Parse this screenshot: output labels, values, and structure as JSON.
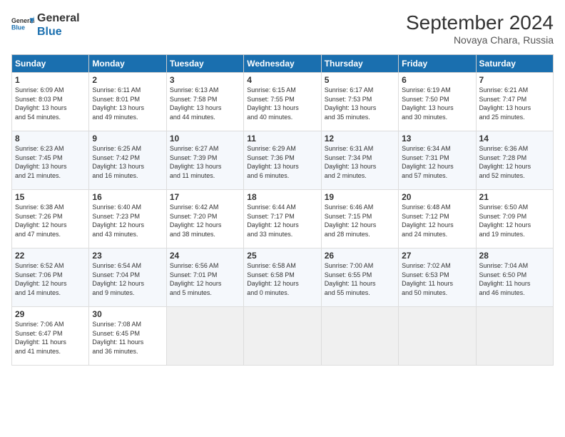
{
  "header": {
    "logo_general": "General",
    "logo_blue": "Blue",
    "month": "September 2024",
    "location": "Novaya Chara, Russia"
  },
  "weekdays": [
    "Sunday",
    "Monday",
    "Tuesday",
    "Wednesday",
    "Thursday",
    "Friday",
    "Saturday"
  ],
  "weeks": [
    [
      {
        "day": "1",
        "info": "Sunrise: 6:09 AM\nSunset: 8:03 PM\nDaylight: 13 hours\nand 54 minutes."
      },
      {
        "day": "2",
        "info": "Sunrise: 6:11 AM\nSunset: 8:01 PM\nDaylight: 13 hours\nand 49 minutes."
      },
      {
        "day": "3",
        "info": "Sunrise: 6:13 AM\nSunset: 7:58 PM\nDaylight: 13 hours\nand 44 minutes."
      },
      {
        "day": "4",
        "info": "Sunrise: 6:15 AM\nSunset: 7:55 PM\nDaylight: 13 hours\nand 40 minutes."
      },
      {
        "day": "5",
        "info": "Sunrise: 6:17 AM\nSunset: 7:53 PM\nDaylight: 13 hours\nand 35 minutes."
      },
      {
        "day": "6",
        "info": "Sunrise: 6:19 AM\nSunset: 7:50 PM\nDaylight: 13 hours\nand 30 minutes."
      },
      {
        "day": "7",
        "info": "Sunrise: 6:21 AM\nSunset: 7:47 PM\nDaylight: 13 hours\nand 25 minutes."
      }
    ],
    [
      {
        "day": "8",
        "info": "Sunrise: 6:23 AM\nSunset: 7:45 PM\nDaylight: 13 hours\nand 21 minutes."
      },
      {
        "day": "9",
        "info": "Sunrise: 6:25 AM\nSunset: 7:42 PM\nDaylight: 13 hours\nand 16 minutes."
      },
      {
        "day": "10",
        "info": "Sunrise: 6:27 AM\nSunset: 7:39 PM\nDaylight: 13 hours\nand 11 minutes."
      },
      {
        "day": "11",
        "info": "Sunrise: 6:29 AM\nSunset: 7:36 PM\nDaylight: 13 hours\nand 6 minutes."
      },
      {
        "day": "12",
        "info": "Sunrise: 6:31 AM\nSunset: 7:34 PM\nDaylight: 13 hours\nand 2 minutes."
      },
      {
        "day": "13",
        "info": "Sunrise: 6:34 AM\nSunset: 7:31 PM\nDaylight: 12 hours\nand 57 minutes."
      },
      {
        "day": "14",
        "info": "Sunrise: 6:36 AM\nSunset: 7:28 PM\nDaylight: 12 hours\nand 52 minutes."
      }
    ],
    [
      {
        "day": "15",
        "info": "Sunrise: 6:38 AM\nSunset: 7:26 PM\nDaylight: 12 hours\nand 47 minutes."
      },
      {
        "day": "16",
        "info": "Sunrise: 6:40 AM\nSunset: 7:23 PM\nDaylight: 12 hours\nand 43 minutes."
      },
      {
        "day": "17",
        "info": "Sunrise: 6:42 AM\nSunset: 7:20 PM\nDaylight: 12 hours\nand 38 minutes."
      },
      {
        "day": "18",
        "info": "Sunrise: 6:44 AM\nSunset: 7:17 PM\nDaylight: 12 hours\nand 33 minutes."
      },
      {
        "day": "19",
        "info": "Sunrise: 6:46 AM\nSunset: 7:15 PM\nDaylight: 12 hours\nand 28 minutes."
      },
      {
        "day": "20",
        "info": "Sunrise: 6:48 AM\nSunset: 7:12 PM\nDaylight: 12 hours\nand 24 minutes."
      },
      {
        "day": "21",
        "info": "Sunrise: 6:50 AM\nSunset: 7:09 PM\nDaylight: 12 hours\nand 19 minutes."
      }
    ],
    [
      {
        "day": "22",
        "info": "Sunrise: 6:52 AM\nSunset: 7:06 PM\nDaylight: 12 hours\nand 14 minutes."
      },
      {
        "day": "23",
        "info": "Sunrise: 6:54 AM\nSunset: 7:04 PM\nDaylight: 12 hours\nand 9 minutes."
      },
      {
        "day": "24",
        "info": "Sunrise: 6:56 AM\nSunset: 7:01 PM\nDaylight: 12 hours\nand 5 minutes."
      },
      {
        "day": "25",
        "info": "Sunrise: 6:58 AM\nSunset: 6:58 PM\nDaylight: 12 hours\nand 0 minutes."
      },
      {
        "day": "26",
        "info": "Sunrise: 7:00 AM\nSunset: 6:55 PM\nDaylight: 11 hours\nand 55 minutes."
      },
      {
        "day": "27",
        "info": "Sunrise: 7:02 AM\nSunset: 6:53 PM\nDaylight: 11 hours\nand 50 minutes."
      },
      {
        "day": "28",
        "info": "Sunrise: 7:04 AM\nSunset: 6:50 PM\nDaylight: 11 hours\nand 46 minutes."
      }
    ],
    [
      {
        "day": "29",
        "info": "Sunrise: 7:06 AM\nSunset: 6:47 PM\nDaylight: 11 hours\nand 41 minutes."
      },
      {
        "day": "30",
        "info": "Sunrise: 7:08 AM\nSunset: 6:45 PM\nDaylight: 11 hours\nand 36 minutes."
      },
      {
        "day": "",
        "info": ""
      },
      {
        "day": "",
        "info": ""
      },
      {
        "day": "",
        "info": ""
      },
      {
        "day": "",
        "info": ""
      },
      {
        "day": "",
        "info": ""
      }
    ]
  ]
}
